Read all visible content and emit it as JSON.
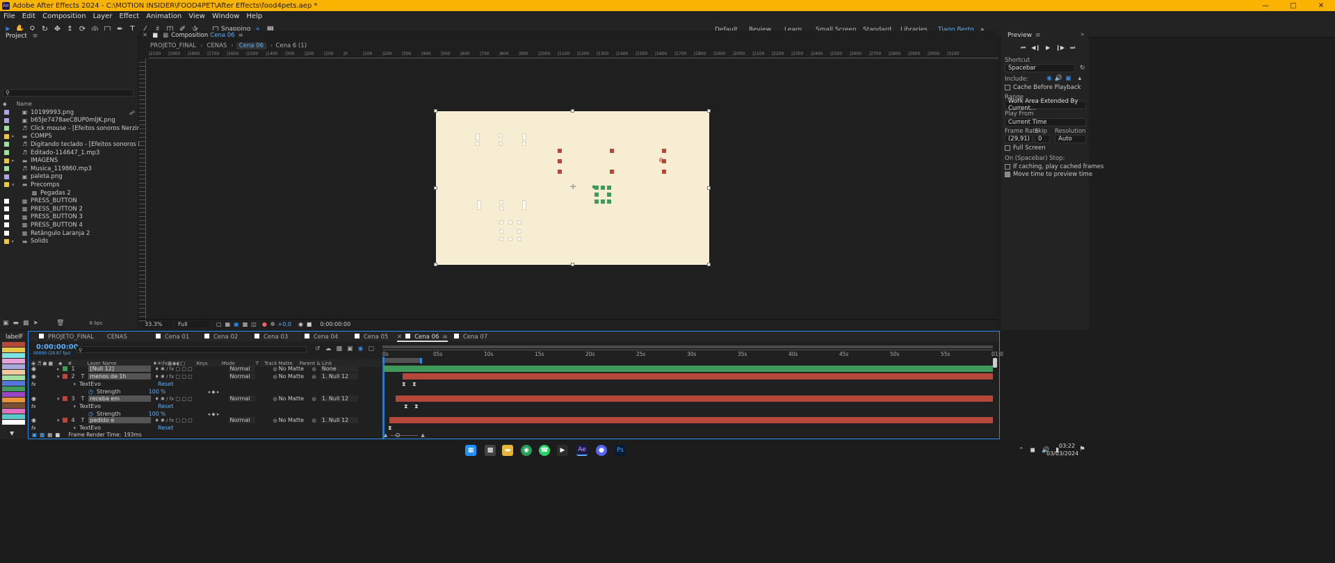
{
  "window": {
    "title": "Adobe After Effects 2024 - C:\\MOTION INSIDER\\FOOD4PET\\After Effects\\food4pets.aep *",
    "app_icon": "Ae"
  },
  "menu": [
    "File",
    "Edit",
    "Composition",
    "Layer",
    "Effect",
    "Animation",
    "View",
    "Window",
    "Help"
  ],
  "toolbar": {
    "snapping": "Snapping"
  },
  "workspaces": [
    "Default",
    "Review",
    "Learn",
    "Small Screen",
    "Standard",
    "Libraries",
    "Tiago Berto"
  ],
  "project": {
    "title": "Project",
    "search_placeholder": "",
    "col_name": "Name",
    "items": [
      {
        "name": "10199993.png",
        "color": "#a9a6e0",
        "icon": "image-icon",
        "indent": 0
      },
      {
        "name": "b65Je7478aeC8UP0mlJK.png",
        "color": "#a9a6e0",
        "icon": "image-icon",
        "indent": 0
      },
      {
        "name": "Click mouse - [Efeitos sonoros Nerzinho].mp3",
        "color": "#a2e0a1",
        "icon": "audio-icon",
        "indent": 0
      },
      {
        "name": "COMPS",
        "color": "#e8c64a",
        "icon": "folder-icon",
        "indent": 0
      },
      {
        "name": "Digitando teclado - [Efeitos sonoros Nerzinho].mp",
        "color": "#a2e0a1",
        "icon": "audio-icon",
        "indent": 0
      },
      {
        "name": "Editado-114647_1.mp3",
        "color": "#a2e0a1",
        "icon": "audio-icon",
        "indent": 0
      },
      {
        "name": "IMAGENS",
        "color": "#e8c64a",
        "icon": "folder-icon",
        "indent": 0
      },
      {
        "name": "Musica_119860.mp3",
        "color": "#a2e0a1",
        "icon": "audio-icon",
        "indent": 0
      },
      {
        "name": "paleta.png",
        "color": "#a9a6e0",
        "icon": "image-icon",
        "indent": 0
      },
      {
        "name": "Precomps",
        "color": "#e8c64a",
        "icon": "folder-icon",
        "indent": 0
      },
      {
        "name": "Pegadas 2",
        "color": "",
        "icon": "comp-icon",
        "indent": 1
      },
      {
        "name": "PRESS_BUTTON",
        "color": "#ffffff",
        "icon": "comp-icon",
        "indent": 0
      },
      {
        "name": "PRESS_BUTTON 2",
        "color": "#ffffff",
        "icon": "comp-icon",
        "indent": 0
      },
      {
        "name": "PRESS_BUTTON 3",
        "color": "#ffffff",
        "icon": "comp-icon",
        "indent": 0
      },
      {
        "name": "PRESS_BUTTON 4",
        "color": "#ffffff",
        "icon": "comp-icon",
        "indent": 0
      },
      {
        "name": "Retângulo Laranja 2",
        "color": "#ffffff",
        "icon": "comp-icon",
        "indent": 0
      },
      {
        "name": "Solids",
        "color": "#e8c64a",
        "icon": "folder-icon",
        "indent": 0
      }
    ],
    "bpc": "8 bpc"
  },
  "composition": {
    "panel_label": "Composition",
    "comp_name": "Cena 06",
    "breadcrumbs": [
      "PROJETO_FINAL",
      "CENAS",
      "Cena 06",
      "Cena 6 (1)"
    ],
    "ruler_ticks": [
      "|2100",
      "|1900",
      "|1800",
      "|1700",
      "|1600",
      "|1500",
      "|1400",
      "|300",
      "|200",
      "|100",
      "|0",
      "|100",
      "|200",
      "|300",
      "|400",
      "|500",
      "|600",
      "|700",
      "|800",
      "|900",
      "|1000",
      "|1100",
      "|1200",
      "|1300",
      "|1400",
      "|1500",
      "|1600",
      "|1700",
      "|1800",
      "|1900",
      "|2000",
      "|2100",
      "|2200",
      "|2300",
      "|2400",
      "|2500",
      "|2600",
      "|2700",
      "|2800",
      "|2900",
      "|3000",
      "|3100"
    ],
    "zoom": "33.3%",
    "resolution": "Full",
    "exposure": "+0,0",
    "timecode": "0:00:00:00"
  },
  "timeline": {
    "tabs": [
      "PROJETO_FINAL",
      "CENAS",
      "Cena 01",
      "Cena 02",
      "Cena 03",
      "Cena 04",
      "Cena 05",
      "Cena 06",
      "Cena 07"
    ],
    "active_tab": "Cena 06",
    "timecode": "0:00:00:00",
    "fps": "00000 (29.97 fps)",
    "search_placeholder": "",
    "label_panel": "labelF",
    "columns": {
      "layer_name": "Layer Name",
      "keys": "Keys",
      "mode": "Mode",
      "t": "T",
      "track_matte": "Track Matte",
      "parent": "Parent & Link"
    },
    "ruler": [
      "0s",
      "05s",
      "10s",
      "15s",
      "20s",
      "25s",
      "30s",
      "35s",
      "40s",
      "45s",
      "50s",
      "55s",
      "01:0"
    ],
    "layers": [
      {
        "num": "1",
        "type": "",
        "name": "[Null 12]",
        "mode": "Normal",
        "matte": "No Matte",
        "parent": "None",
        "color": "#3f9a5b"
      },
      {
        "num": "2",
        "type": "T",
        "name": "menos de 1h",
        "mode": "Normal",
        "matte": "No Matte",
        "parent": "1. Null 12",
        "color": "#b5483a"
      },
      {
        "num": "3",
        "type": "T",
        "name": "receba em",
        "mode": "Normal",
        "matte": "No Matte",
        "parent": "1. Null 12",
        "color": "#b5483a"
      },
      {
        "num": "4",
        "type": "T",
        "name": "pedido e",
        "mode": "Normal",
        "matte": "No Matte",
        "parent": "1. Null 12",
        "color": "#b5483a"
      }
    ],
    "effect": {
      "name": "TextEvo",
      "reset": "Reset",
      "prop": "Strength",
      "value": "100",
      "unit": "%"
    },
    "render_time_label": "Frame Render Time:",
    "render_time": "193ms"
  },
  "preview": {
    "title": "Preview",
    "shortcut_label": "Shortcut",
    "shortcut": "Spacebar",
    "include_label": "Include:",
    "cache_before": "Cache Before Playback",
    "range_label": "Range",
    "range": "Work Area Extended By Current...",
    "play_from_label": "Play From",
    "play_from": "Current Time",
    "frame_rate_label": "Frame Rate",
    "skip_label": "Skip",
    "resolution_label": "Resolution",
    "frame_rate": "(29,91)",
    "skip": "0",
    "resolution": "Auto",
    "full_screen": "Full Screen",
    "on_stop_label": "On (Spacebar) Stop:",
    "if_caching": "If caching, play cached frames",
    "move_time": "Move time to preview time"
  },
  "taskbar": {
    "time": "03:22",
    "date": "03/03/2024"
  },
  "colors": {
    "accent": "#2d8ceb",
    "title_bar": "#fab300",
    "canvas": "#f6edd3",
    "green": "#3f9a5b",
    "red": "#b5483a"
  }
}
